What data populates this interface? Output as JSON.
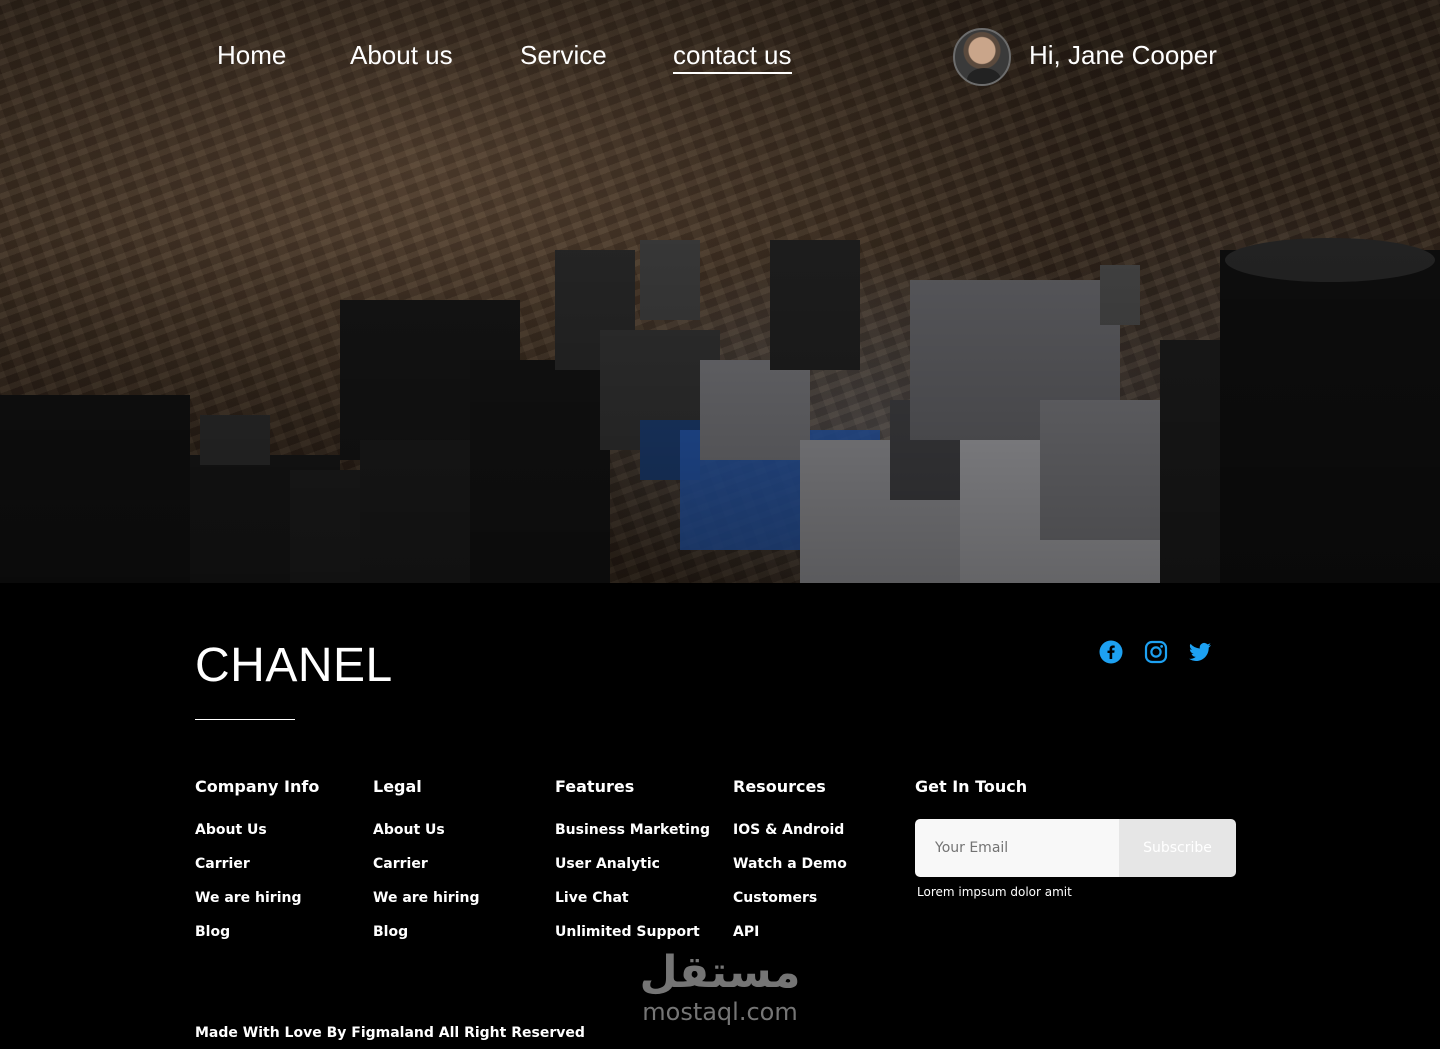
{
  "nav": {
    "items": [
      {
        "label": "Home",
        "active": false
      },
      {
        "label": "About us",
        "active": false
      },
      {
        "label": "Service",
        "active": false
      },
      {
        "label": "contact us",
        "active": true
      }
    ],
    "greeting": "Hi, Jane Cooper",
    "avatar_icon": "user-avatar"
  },
  "footer": {
    "brand": "CHANEL",
    "social": [
      {
        "icon": "facebook-icon",
        "color": "#1da1f2"
      },
      {
        "icon": "instagram-icon",
        "color": "#1da1f2"
      },
      {
        "icon": "twitter-icon",
        "color": "#1da1f2"
      }
    ],
    "columns": {
      "company": {
        "title": "Company Info",
        "links": [
          "About Us",
          "Carrier",
          "We are hiring",
          "Blog"
        ]
      },
      "legal": {
        "title": "Legal",
        "links": [
          "About Us",
          "Carrier",
          "We are hiring",
          "Blog"
        ]
      },
      "features": {
        "title": "Features",
        "links": [
          "Business Marketing",
          "User Analytic",
          "Live Chat",
          "Unlimited Support"
        ]
      },
      "resources": {
        "title": "Resources",
        "links": [
          "IOS & Android",
          "Watch a Demo",
          "Customers",
          "API"
        ]
      }
    },
    "touch": {
      "title": "Get In Touch",
      "email_placeholder": "Your Email",
      "email_value": "",
      "subscribe_label": "Subscribe",
      "note": "Lorem impsum dolor amit"
    },
    "watermark": {
      "arabic": "مستقل",
      "latin": "mostaql.com"
    },
    "copyright": "Made With Love By Figmaland All Right Reserved"
  },
  "colors": {
    "background": "#000000",
    "accent_social": "#1da1f2",
    "text": "#ffffff"
  }
}
